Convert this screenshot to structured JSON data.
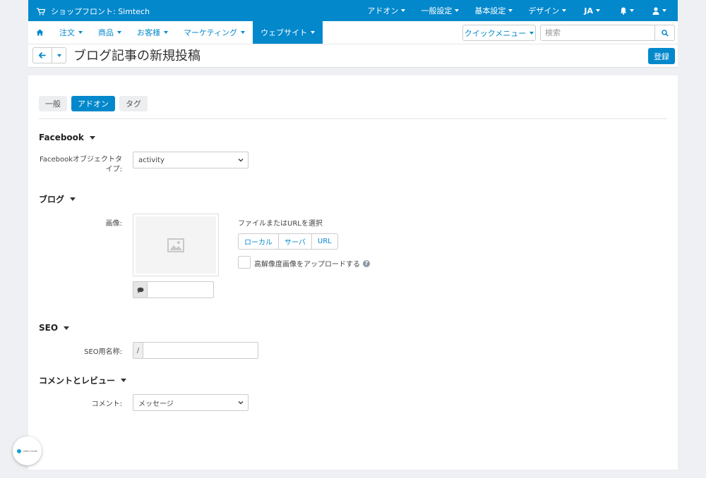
{
  "topbar": {
    "store_name": "ショップフロント: Simtech",
    "menus": [
      "アドオン",
      "一般設定",
      "基本設定",
      "デザイン",
      "JA"
    ]
  },
  "nav": {
    "items": [
      "注文",
      "商品",
      "お客様",
      "マーケティング",
      "ウェブサイト"
    ],
    "active_index": 4,
    "quick_menu": "クイックメニュー",
    "search_placeholder": "検索"
  },
  "page": {
    "title": "ブログ記事の新規投稿",
    "save_label": "登録"
  },
  "tabs": [
    {
      "label": "一般",
      "active": false
    },
    {
      "label": "アドオン",
      "active": true
    },
    {
      "label": "タグ",
      "active": false
    }
  ],
  "facebook": {
    "heading": "Facebook",
    "object_type_label": "Facebookオブジェクトタイプ:",
    "object_type_value": "activity"
  },
  "blog": {
    "heading": "ブログ",
    "image_label": "画像:",
    "file_or_url": "ファイルまたはURLを選択",
    "buttons": [
      "ローカル",
      "サーバ",
      "URL"
    ],
    "hires_label": "高解像度画像をアップロードする"
  },
  "seo": {
    "heading": "SEO",
    "name_label": "SEO用名称:",
    "prefix": "/"
  },
  "comments": {
    "heading": "コメントとレビュー",
    "label": "コメント:",
    "value": "メッセージ"
  },
  "badge": {
    "text": "DEMO STORE"
  },
  "colors": {
    "accent": "#0388cc"
  }
}
